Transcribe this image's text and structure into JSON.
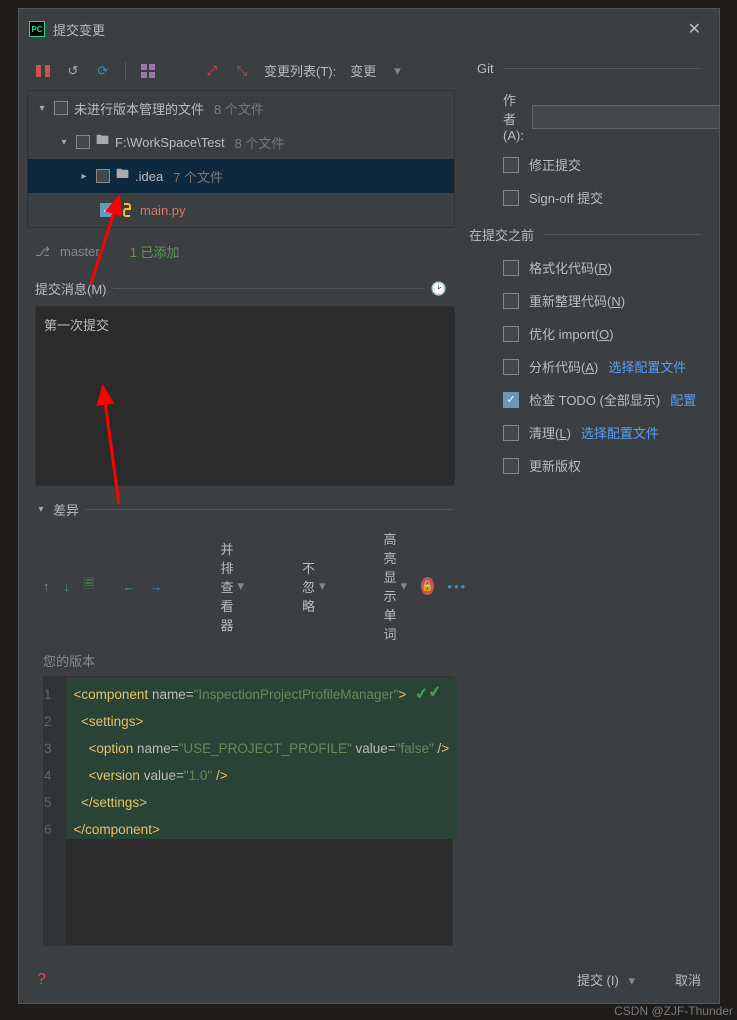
{
  "title": "提交变更",
  "toolbar": {
    "changelist_label": "变更列表(T):",
    "changelist_value": "变更"
  },
  "tree": {
    "root": {
      "label": "未进行版本管理的文件",
      "count": "8 个文件"
    },
    "workspace": {
      "label": "F:\\WorkSpace\\Test",
      "count": "8 个文件"
    },
    "idea": {
      "label": ".idea",
      "count": "7 个文件"
    },
    "main": {
      "label": "main.py"
    }
  },
  "branch": {
    "name": "master",
    "added": "1 已添加"
  },
  "commit_msg": {
    "header": "提交消息(M)",
    "text": "第一次提交"
  },
  "diff": {
    "header": "差异",
    "viewer": "并排查看器",
    "ignore": "不忽略",
    "highlight": "高亮显示单词",
    "your_version": "您的版本"
  },
  "code": {
    "l1": {
      "open": "<component",
      "attr": " name=",
      "val": "\"InspectionProjectProfileManager\"",
      "close": ">"
    },
    "l2": {
      "open": "<settings>",
      "close": ""
    },
    "l3": {
      "open": "<option",
      "attr": " name=",
      "v1": "\"USE_PROJECT_PROFILE\"",
      "attr2": " value=",
      "v2": "\"false\"",
      "close": " />"
    },
    "l4": {
      "open": "<version",
      "attr": " value=",
      "v1": "\"1.0\"",
      "close": " />"
    },
    "l5": "</settings>",
    "l6": "</component>"
  },
  "git": {
    "header": "Git",
    "author": "作者(A):",
    "amend": "修正提交",
    "signoff": "Sign-off 提交"
  },
  "before": {
    "header": "在提交之前",
    "reformat": "格式化代码(R)",
    "rearrange": "重新整理代码(N)",
    "optimize": "优化 import(O)",
    "analyze": "分析代码(A)",
    "analyze_link": "选择配置文件",
    "todo": "检查 TODO (全部显示)",
    "todo_link": "配置",
    "cleanup": "清理(L)",
    "cleanup_link": "选择配置文件",
    "copyright": "更新版权"
  },
  "footer": {
    "commit": "提交 (I)",
    "cancel": "取消"
  },
  "watermark": "CSDN @ZJF-Thunder"
}
